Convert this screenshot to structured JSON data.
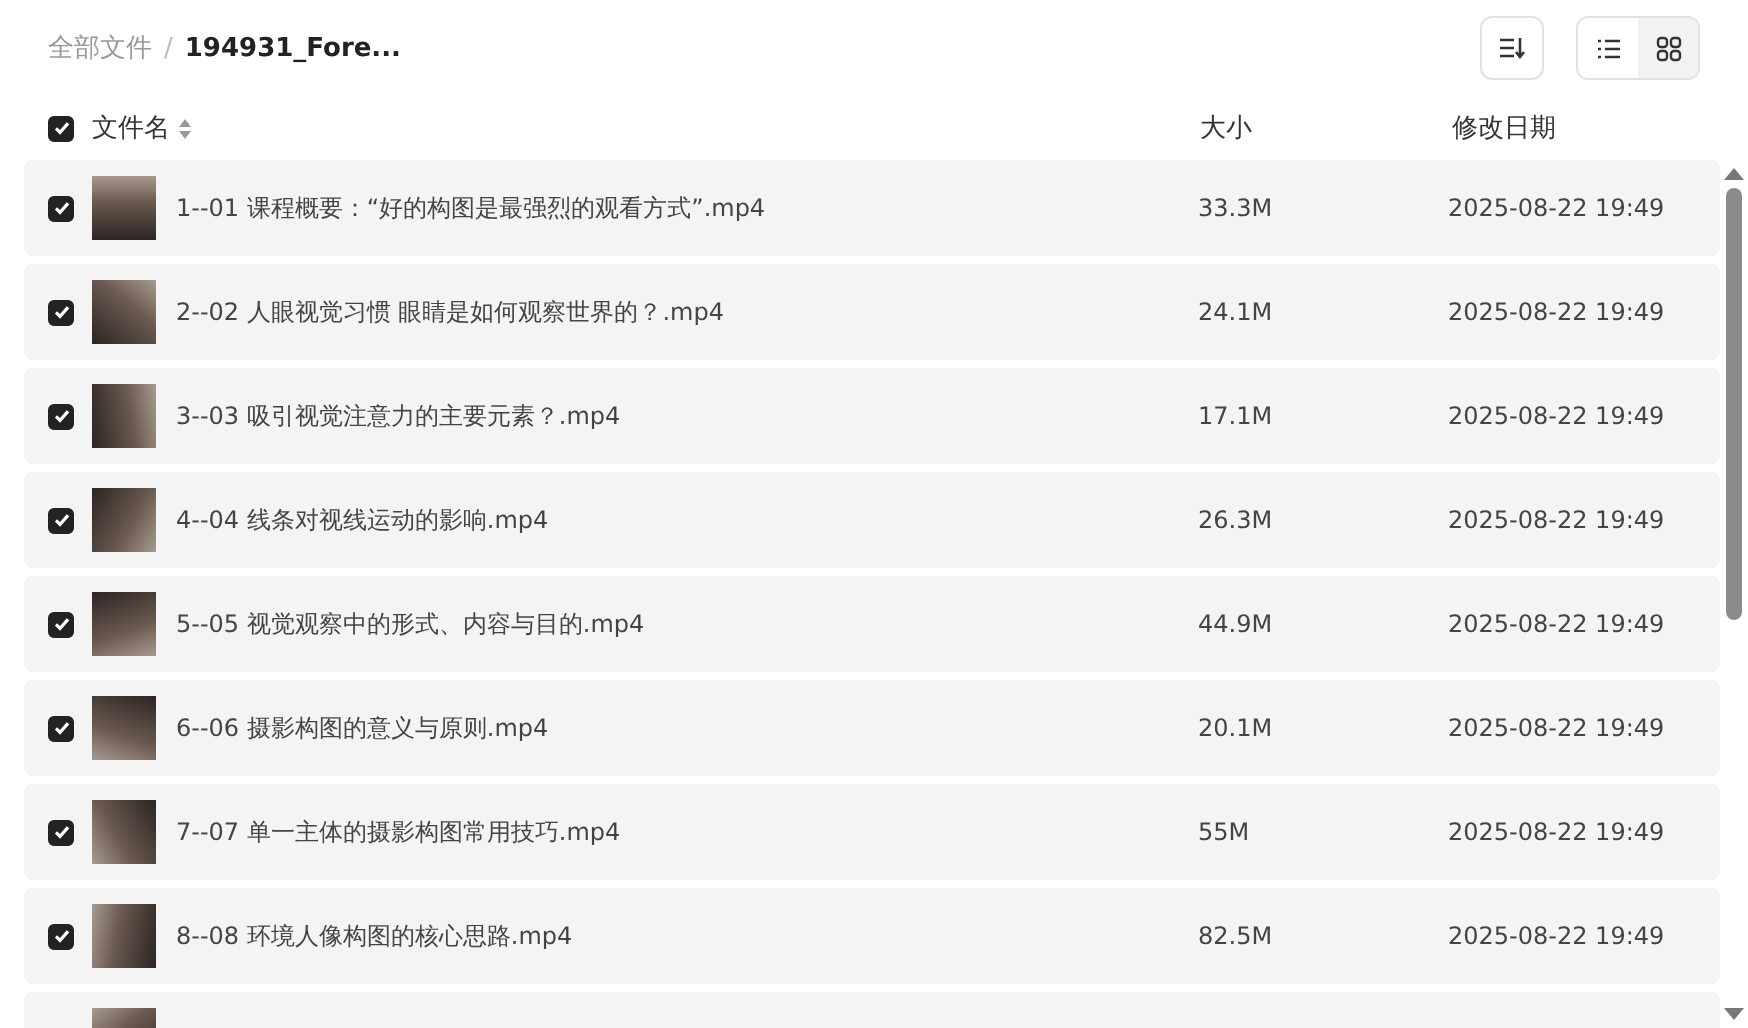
{
  "breadcrumb_separator": "/",
  "breadcrumb": [
    {
      "label": "全部文件",
      "current": false
    },
    {
      "label": "194931_Fore...",
      "current": true
    }
  ],
  "view_modes": [
    {
      "kind": "list",
      "selected": true
    },
    {
      "kind": "grid",
      "selected": false
    }
  ],
  "columns": {
    "name": "文件名",
    "size": "大小",
    "date": "修改日期"
  },
  "select_all": {
    "checked": true
  },
  "files": [
    {
      "checked": true,
      "name": "1--01 课程概要：“好的构图是最强烈的观看方式”.mp4",
      "size": "33.3M",
      "date": "2025-08-22 19:49"
    },
    {
      "checked": true,
      "name": "2--02 人眼视觉习惯 眼睛是如何观察世界的？.mp4",
      "size": "24.1M",
      "date": "2025-08-22 19:49"
    },
    {
      "checked": true,
      "name": "3--03 吸引视觉注意力的主要元素？.mp4",
      "size": "17.1M",
      "date": "2025-08-22 19:49"
    },
    {
      "checked": true,
      "name": "4--04 线条对视线运动的影响.mp4",
      "size": "26.3M",
      "date": "2025-08-22 19:49"
    },
    {
      "checked": true,
      "name": "5--05 视觉观察中的形式、内容与目的.mp4",
      "size": "44.9M",
      "date": "2025-08-22 19:49"
    },
    {
      "checked": true,
      "name": "6--06 摄影构图的意义与原则.mp4",
      "size": "20.1M",
      "date": "2025-08-22 19:49"
    },
    {
      "checked": true,
      "name": "7--07 单一主体的摄影构图常用技巧.mp4",
      "size": "55M",
      "date": "2025-08-22 19:49"
    },
    {
      "checked": true,
      "name": "8--08 环境人像构图的核心思路.mp4",
      "size": "82.5M",
      "date": "2025-08-22 19:49"
    },
    {
      "cut_off": true
    }
  ]
}
